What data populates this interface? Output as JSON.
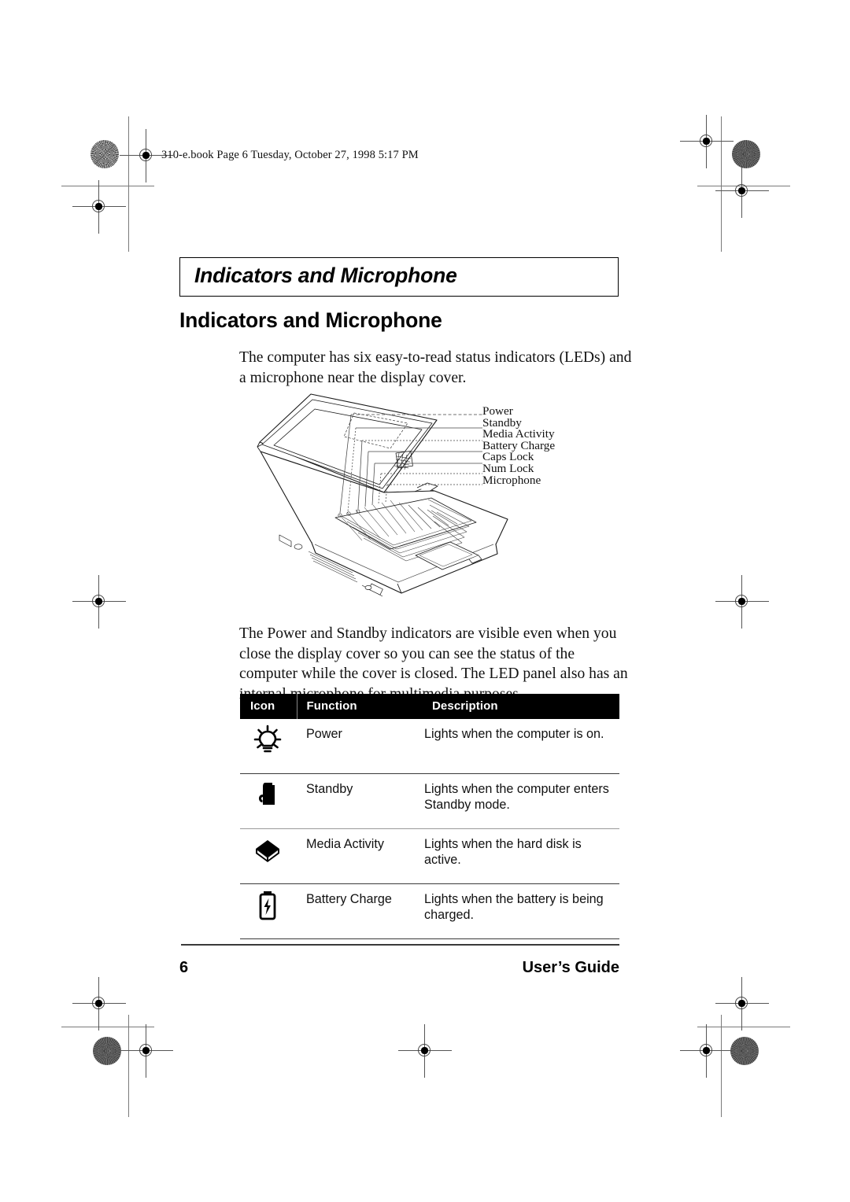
{
  "print_marks": {
    "file_stamp": "310-e.book  Page 6  Tuesday, October 27, 1998  5:17 PM"
  },
  "running_header": {
    "text": "Indicators and Microphone"
  },
  "heading": {
    "title": "Indicators and Microphone"
  },
  "paragraphs": {
    "intro": "The computer has six easy-to-read status indicators (LEDs) and a microphone near the display cover.",
    "visible": "The Power and Standby indicators are visible even when you close the display cover so you can see the status of the computer while the cover is closed.  The LED panel also has an internal microphone for multimedia purposes."
  },
  "figure": {
    "alt": "line drawing of an open notebook computer with leader lines to the LED panel",
    "callouts": [
      "Power",
      "Standby",
      "Media Activity",
      "Battery Charge",
      "Caps Lock",
      "Num Lock",
      "Microphone"
    ]
  },
  "table": {
    "headers": [
      "Icon",
      "Function",
      "Description"
    ],
    "rows": [
      {
        "icon": "lightbulb-icon",
        "function": "Power",
        "description": "Lights when the computer is on."
      },
      {
        "icon": "standby-moon-icon",
        "function": "Standby",
        "description": "Lights when the computer enters Standby mode."
      },
      {
        "icon": "media-disk-icon",
        "function": "Media Activity",
        "description": "Lights when the hard disk is active."
      },
      {
        "icon": "battery-charge-icon",
        "function": "Battery Charge",
        "description": "Lights when the battery is being charged."
      }
    ]
  },
  "footer": {
    "page_number": "6",
    "guide_label": "User’s Guide"
  },
  "colors": {
    "text": "#111111",
    "rule": "#3a3a3a",
    "table_header_bg": "#000000",
    "table_header_text": "#ffffff"
  }
}
